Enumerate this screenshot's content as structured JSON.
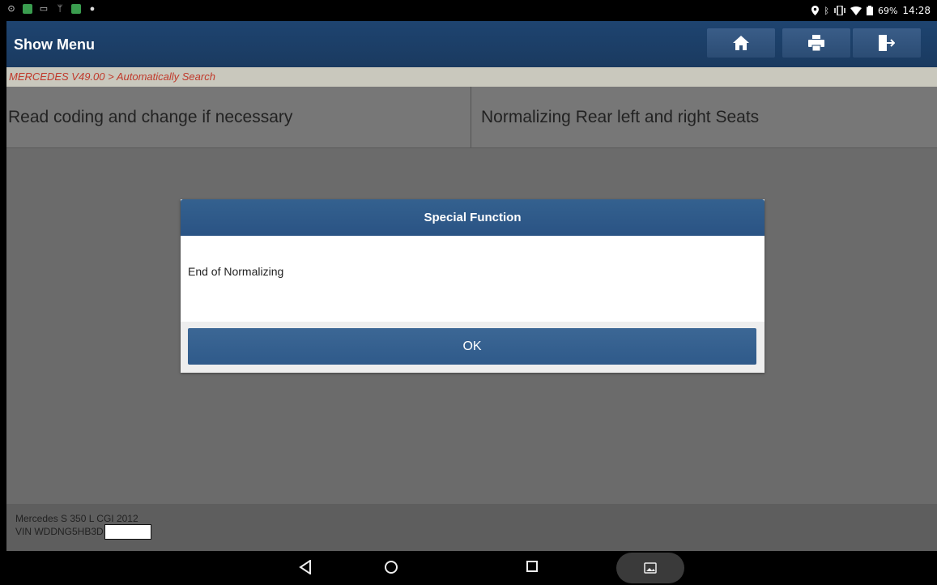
{
  "status_bar": {
    "battery": "69%",
    "time": "14:28",
    "left_icons": [
      "alarm-icon",
      "app-icon",
      "image-icon",
      "usb-debug-icon",
      "app-icon",
      "location-search-icon"
    ],
    "right_icons": [
      "location-icon",
      "bluetooth-icon",
      "vibrate-icon",
      "wifi-icon",
      "battery-icon"
    ]
  },
  "header": {
    "title": "Show Menu",
    "buttons": [
      "home-icon",
      "print-icon",
      "exit-icon"
    ]
  },
  "breadcrumb": "MERCEDES V49.00 > Automatically Search",
  "menu": {
    "items": [
      {
        "label": "Read coding and change if necessary"
      },
      {
        "label": "Normalizing Rear left and right Seats"
      }
    ]
  },
  "dialog": {
    "title": "Special Function",
    "message": "End of Normalizing",
    "ok_label": "OK"
  },
  "footer": {
    "vehicle": "Mercedes S 350 L CGI 2012",
    "vin": "VIN WDDNG5HB3D"
  },
  "nav_bar": {
    "buttons": [
      "back-icon",
      "home-circle-icon",
      "recents-icon",
      "screenshot-icon"
    ]
  },
  "colors": {
    "header_bg": "#1e4470",
    "breadcrumb_text": "#c0392b",
    "dialog_header": "#2f5a8a",
    "background": "#6b6b6b"
  }
}
